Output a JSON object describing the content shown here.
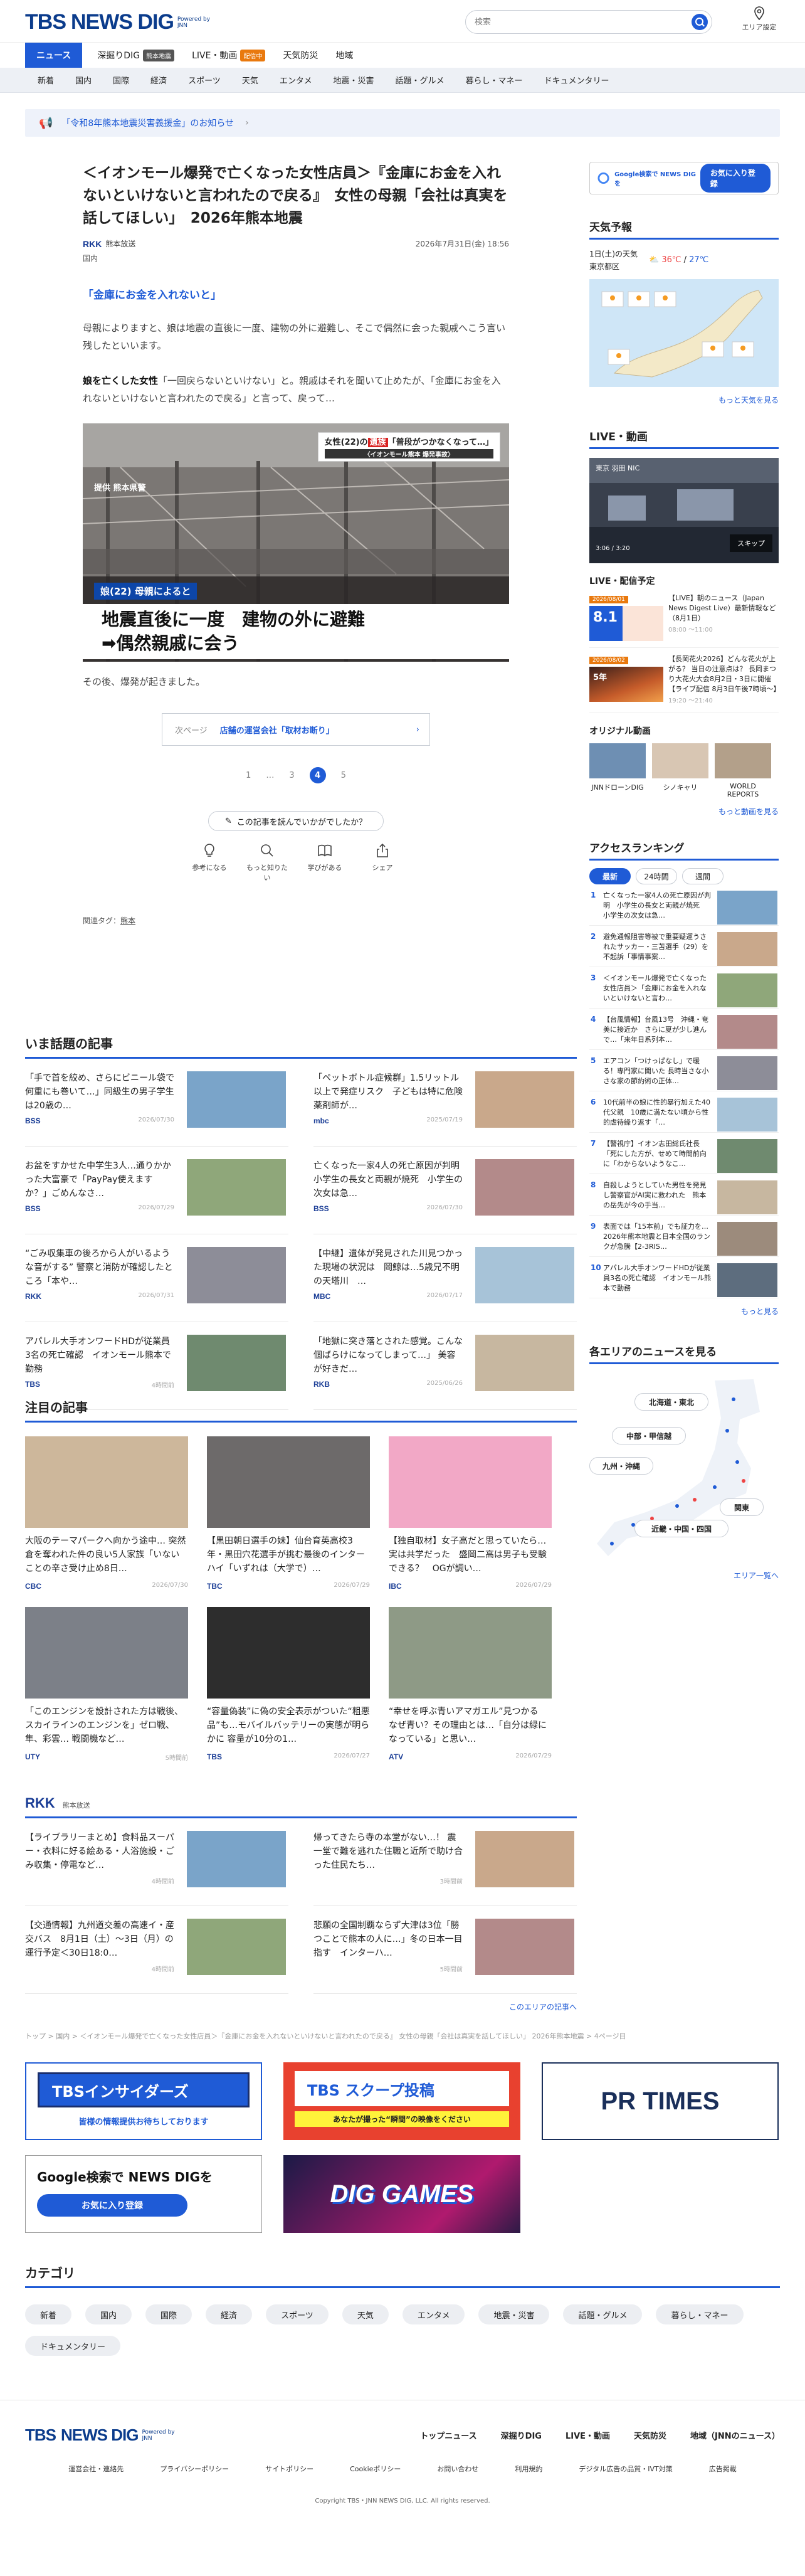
{
  "header": {
    "logo_tbs": "TBS",
    "logo_dig": "NEWS DIG",
    "powered": "Powered by JNN",
    "search_placeholder": "検索",
    "area_label": "エリア設定"
  },
  "nav": {
    "items": [
      {
        "label": "ニュース"
      },
      {
        "label": "深掘りDIG",
        "tag": "熊本地震"
      },
      {
        "label": "LIVE・動画",
        "tag": "配信中"
      },
      {
        "label": "天気防災"
      },
      {
        "label": "地域"
      }
    ]
  },
  "subnav": [
    "新着",
    "国内",
    "国際",
    "経済",
    "スポーツ",
    "天気",
    "エンタメ",
    "地震・災害",
    "話題・グルメ",
    "暮らし・マネー",
    "ドキュメンタリー"
  ],
  "notice": {
    "text": "「令和8年熊本地震災害義援金」のお知らせ"
  },
  "article": {
    "title": "＜イオンモール爆発で亡くなった女性店員＞『金庫にお金を入れないといけないと言われたので戻る』　女性の母親「会社は真実を話してほしい」　2026年熊本地震",
    "source_logo": "RKK",
    "source": "熊本放送",
    "date": "2026年7月31日(金) 18:56",
    "category": "国内",
    "kicker": "「金庫にお金を入れないと」",
    "para1": "母親によりますと、娘は地震の直後に一度、建物の外に避難し、そこで偶然に会った親戚へこう言い残したといいます。",
    "para2_bold": "娘を亡くした女性",
    "para2": "「一回戻らないといけない」と。親戚はそれを聞いて止めたが、「金庫にお金を入れないといけないと言われたので戻る」と言って、戻って…",
    "photo_top_label": "女性(22)の",
    "photo_top_accent": "遺族",
    "photo_top_rest": "「普段がつかなくなって…」",
    "photo_top_sub": "〈イオンモール熊本 爆発事故〉",
    "photo_credit": "提供 熊本県警",
    "photo_sub": "娘(22) 母親によると",
    "photo_caption1": "地震直後に一度　建物の外に避難",
    "photo_caption2": "➡偶然親戚に会う",
    "caption": "その後、爆発が起きました。",
    "next_label": "次ページ",
    "next_title": "店舗の運営会社「取材お断り」",
    "pager": [
      "1",
      "…",
      "3",
      "4",
      "5"
    ],
    "survey_q": "この記事を読んでいかがでしたか？",
    "reacts": [
      "参考になる",
      "もっと知りたい",
      "学びがある",
      "シェア"
    ],
    "tags_label": "関連タグ：",
    "tags_value": "熊本"
  },
  "topics": {
    "title": "いま話題の記事",
    "items": [
      {
        "text": "「手で首を絞め、さらにビニール袋で何重にも巻いて…」同級生の男子学生は20歳の…",
        "brand": "BSS",
        "date": "2026/07/30"
      },
      {
        "text": "「ペットボトル症候群」1.5リットル以上で発症リスク　子どもは特に危険　薬剤師が…",
        "brand": "mbc",
        "date": "2025/07/19"
      },
      {
        "text": "お盆をすかせた中学生3人…通りかかった大富豪で「PayPay使えますか？」ごめんなさ…",
        "brand": "BSS",
        "date": "2026/07/29"
      },
      {
        "text": "亡くなった一家4人の死亡原因が判明　小学生の長女と両親が焼死　小学生の次女は急…",
        "brand": "BSS",
        "date": "2026/07/30"
      },
      {
        "text": "“ごみ収集車の後ろから人がいるような音がする” 警察と消防が確認したところ「本や…",
        "brand": "RKK",
        "date": "2026/07/31"
      },
      {
        "text": "【中継】遺体が発見された川見つかった現場の状況は　岡鯨は…5歳兄不明の天塔川　…",
        "brand": "MBC",
        "date": "2026/07/17"
      },
      {
        "text": "アパレル大手オンワードHDが従業員3名の死亡確認　イオンモール熊本で勤務",
        "brand": "TBS",
        "date": "4時間前"
      },
      {
        "text": "「地獄に突き落とされた感覚。こんな個ばらけになってしまって…」 美容が好きだ…",
        "brand": "RKB",
        "date": "2025/06/26"
      }
    ]
  },
  "featured": {
    "title": "注目の記事",
    "items": [
      {
        "text": "大阪のテーマパークへ向かう途中… 突然倉を奪われた件の良い5人家族「いないことの辛さ受け止め8日…",
        "brand": "CBC",
        "date": "2026/07/30"
      },
      {
        "text": "【黒田朝日選手の妹】仙台育英高校3年・黒田穴花選手が挑む最後のインターハイ「いずれは（大学で）…",
        "brand": "TBC",
        "date": "2026/07/29"
      },
      {
        "text": "【独自取材】女子高だと思っていたら…実は共学だった　盛岡二高は男子も受験できる？　OGが調い…",
        "brand": "IBC",
        "date": "2026/07/29"
      },
      {
        "text": "「このエンジンを設計された方は戦後、スカイラインのエンジンを」ゼロ戦、隼、彩雲… 戦闘機など…",
        "brand": "UTY",
        "date": "5時間前"
      },
      {
        "text": "“容量偽装”に偽の安全表示がついた“粗悪品”も…モバイルバッテリーの実態が明らかに 容量が10分の1…",
        "brand": "TBS",
        "date": "2026/07/27"
      },
      {
        "text": "“幸せを呼ぶ青いアマガエル”見つかる　なぜ青い？その理由とは…「自分は緑になっている」と思い…",
        "brand": "ATV",
        "date": "2026/07/29"
      }
    ]
  },
  "rkk": {
    "logo": "RKK",
    "name": "熊本放送",
    "items": [
      {
        "text": "【ライブラリーまとめ】食料品スーパー・衣料に好る絵ある・人浴施設・ごみ収集・停電など…",
        "date": "4時間前"
      },
      {
        "text": "帰ってきたら寺の本堂がない…！ 震一堂で難を逃れた住職と近所で助け合った住民たち…",
        "date": "3時間前"
      },
      {
        "text": "【交通情報】九州道交差の高速イ・産交バス　8月1日（土）～3日（月）の運行予定＜30日18:0…",
        "date": "4時間前"
      },
      {
        "text": "悲願の全国制覇ならず大津は3位「勝つことで熊本の人に…」冬の日本一目指す　インターハ…",
        "date": "5時間前"
      }
    ],
    "more": "このエリアの記事へ"
  },
  "sidebar": {
    "gsearch_text": "Google検索で NEWS DIG を",
    "gsearch_btn": "お気に入り登録",
    "weather_title": "天気予報",
    "weather_date": "1日(土)の天気",
    "weather_area": "東京都区",
    "weather_high": "36℃",
    "weather_low": "27℃",
    "weather_more": "もっと天気を見る",
    "live_title": "LIVE・動画",
    "live_video_label": "東京 羽田 NIC",
    "live_skip": "スキップ",
    "live_time": "3:06 / 3:20",
    "live_sched_title": "LIVE・配信予定",
    "live_items": [
      {
        "badge": "8.1",
        "date": "2026/08/01",
        "text": "【LIVE】朝のニュース（Japan News Digest Live）最新情報など（8月1日）",
        "time": "08:00 ～11:00"
      },
      {
        "badge": "5年",
        "date": "2026/08/02",
        "text": "【長岡花火2026】どんな花火が上がる？ 当日の注意点は？ 長岡まつり大花火大会8月2日・3日に開催【ライブ配信 8月3日午後7時頃〜】",
        "time": "19:20 ～21:40"
      }
    ],
    "orig_title": "オリジナル動画",
    "origs": [
      "JNNドローンDIG",
      "シノキャリ",
      "WORLD REPORTS"
    ],
    "orig_more": "もっと動画を見る",
    "rank_title": "アクセスランキング",
    "rank_tabs": [
      "最新",
      "24時間",
      "週間"
    ],
    "rank_items": [
      "亡くなった一家4人の死亡原因が判明　小学生の長女と両親が焼死　小学生の次女は急…",
      "避免通報阻害等被で重要疑運うされたサッカー・三苫選手（29）を不起訴「事情事案…",
      "＜イオンモール爆発で亡くなった女性店員＞「金庫にお金を入れないといけないと言わ…",
      "【台風情報】台風13号　沖縄・奄美に接近か　さらに夏が少し進んで…「来年日系列本…",
      "エアコン「つけっぱなし」で暖る！専門家に聞いた 長時当さな小さな家の節約術の正体…",
      "10代前半の娘に性的暴行加えた40代父親　10歳に満たない頃から性的虐待繰り返す「…",
      "【警視庁】イオン志田総氏社長「死にした方が、せめて時間前向に「わからないようなこ…",
      "自殺しようとしていた男性を発見し警察官がAI実に救われた　熊本の岳先が今の手当…",
      "表面では「15本前」でも証力を…2026年熊本地震と日本全国のランクが急騰【2-3RIS…",
      "アパレル大手オンワードHDが従業員3名の死亡確認　イオンモール熊本で勤務"
    ],
    "rank_more": "もっと見る",
    "area_title": "各エリアのニュースを見る",
    "area_buttons": [
      "北海道・東北",
      "中部・甲信越",
      "九州・沖縄",
      "関東",
      "近畿・中国・四国"
    ],
    "area_more": "エリア一覧へ"
  },
  "breadcrumb": "トップ > 国内 > ＜イオンモール爆発で亡くなった女性店員＞『金庫にお金を入れないといけないと言われたので戻る』 女性の母親「会社は真実を話してほしい」 2026年熊本地震 > 4ページ目",
  "banners": {
    "insiders": "TBSインサイダーズ",
    "insiders_sub": "皆様の情報提供お待ちしております",
    "scoop": "TBS スクープ投稿",
    "scoop_sub": "あなたが撮った“瞬間”の映像をください",
    "prtimes": "PR TIMES",
    "google": "Google検索で NEWS DIGを",
    "google_btn": "お気に入り登録",
    "games": "DIG GAMES"
  },
  "categories": {
    "title": "カテゴリ",
    "chips": [
      "新着",
      "国内",
      "国際",
      "経済",
      "スポーツ",
      "天気",
      "エンタメ",
      "地震・災害",
      "話題・グルメ",
      "暮らし・マネー",
      "ドキュメンタリー"
    ]
  },
  "footer": {
    "links": [
      "トップニュース",
      "深掘りDIG",
      "LIVE・動画",
      "天気防災",
      "地域（JNNのニュース）"
    ],
    "links2": [
      "運営会社・連絡先",
      "プライバシーポリシー",
      "サイトポリシー",
      "Cookieポリシー",
      "お問い合わせ",
      "利用規約",
      "デジタル広告の品質・IVT対策",
      "広告掲載"
    ],
    "copyright": "Copyright TBS・JNN NEWS DIG, LLC. All rights reserved."
  },
  "colors": {
    "accent": "#1f5bd6",
    "brand": "#0b3c8c",
    "orange": "#e9790e"
  }
}
